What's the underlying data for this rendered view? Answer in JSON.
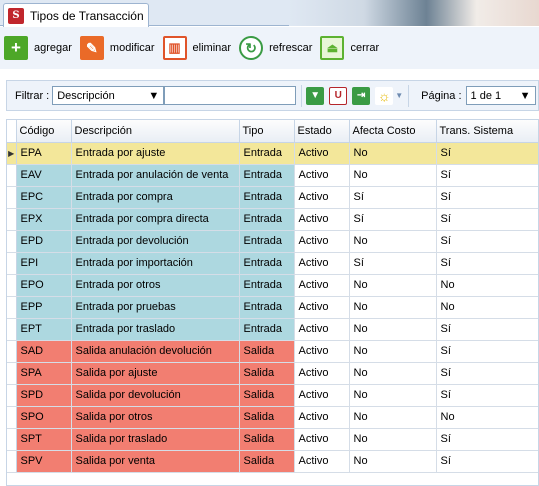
{
  "tab": {
    "title": "Tipos de Transacción",
    "icon": "app-logo-icon"
  },
  "toolbar": {
    "buttons": [
      {
        "label": "agregar",
        "icon": "add-icon"
      },
      {
        "label": "modificar",
        "icon": "edit-icon"
      },
      {
        "label": "eliminar",
        "icon": "trash-icon"
      },
      {
        "label": "refrescar",
        "icon": "refresh-icon"
      },
      {
        "label": "cerrar",
        "icon": "close-doc-icon"
      }
    ]
  },
  "filter": {
    "label": "Filtrar :",
    "field": "Descripción",
    "value": "",
    "icons": [
      "filter-down-icon",
      "magnet-icon",
      "export-icon",
      "sun-icon"
    ]
  },
  "pager": {
    "label": "Página :",
    "value": "1 de 1"
  },
  "colors": {
    "entrada": "#add8e0",
    "salida": "#f27e71",
    "selected": "#f3e79a"
  },
  "grid": {
    "columns": [
      "Código",
      "Descripción",
      "Tipo",
      "Estado",
      "Afecta Costo",
      "Trans. Sistema"
    ],
    "rows": [
      [
        "EPA",
        "Entrada por ajuste",
        "Entrada",
        "Activo",
        "No",
        "Sí"
      ],
      [
        "EAV",
        "Entrada por anulación de venta",
        "Entrada",
        "Activo",
        "No",
        "Sí"
      ],
      [
        "EPC",
        "Entrada por compra",
        "Entrada",
        "Activo",
        "Sí",
        "Sí"
      ],
      [
        "EPX",
        "Entrada por compra directa",
        "Entrada",
        "Activo",
        "Sí",
        "Sí"
      ],
      [
        "EPD",
        "Entrada por devolución",
        "Entrada",
        "Activo",
        "No",
        "Sí"
      ],
      [
        "EPI",
        "Entrada por importación",
        "Entrada",
        "Activo",
        "Sí",
        "Sí"
      ],
      [
        "EPO",
        "Entrada por otros",
        "Entrada",
        "Activo",
        "No",
        "No"
      ],
      [
        "EPP",
        "Entrada por pruebas",
        "Entrada",
        "Activo",
        "No",
        "No"
      ],
      [
        "EPT",
        "Entrada por traslado",
        "Entrada",
        "Activo",
        "No",
        "Sí"
      ],
      [
        "SAD",
        "Salida anulación devolución",
        "Salida",
        "Activo",
        "No",
        "Sí"
      ],
      [
        "SPA",
        "Salida por ajuste",
        "Salida",
        "Activo",
        "No",
        "Sí"
      ],
      [
        "SPD",
        "Salida por devolución",
        "Salida",
        "Activo",
        "No",
        "Sí"
      ],
      [
        "SPO",
        "Salida por otros",
        "Salida",
        "Activo",
        "No",
        "No"
      ],
      [
        "SPT",
        "Salida por traslado",
        "Salida",
        "Activo",
        "No",
        "Sí"
      ],
      [
        "SPV",
        "Salida por venta",
        "Salida",
        "Activo",
        "No",
        "Sí"
      ]
    ]
  }
}
